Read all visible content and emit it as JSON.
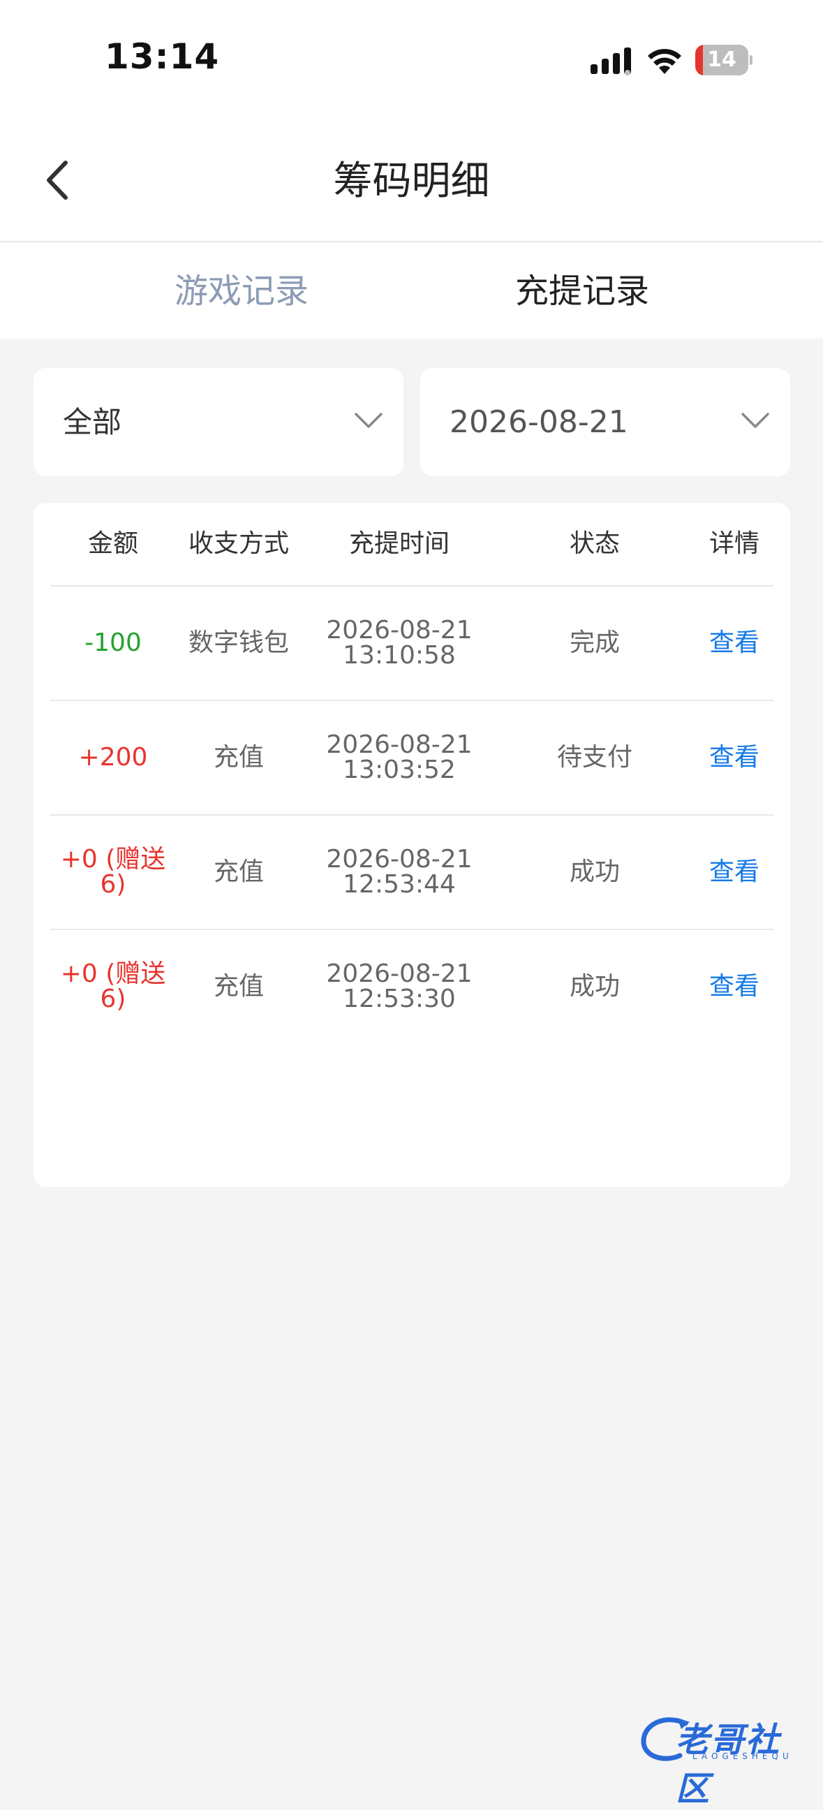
{
  "status_bar": {
    "time": "13:14",
    "battery_level": "14",
    "battery_percent": 14
  },
  "nav": {
    "title": "筹码明细"
  },
  "tabs": [
    {
      "label": "游戏记录",
      "active": false
    },
    {
      "label": "充提记录",
      "active": true
    }
  ],
  "filters": {
    "type": "全部",
    "date": "2026-08-21"
  },
  "table": {
    "headers": [
      "金额",
      "收支方式",
      "充提时间",
      "状态",
      "详情"
    ],
    "rows": [
      {
        "amount": "-100",
        "amount_line2": "",
        "method": "数字钱包",
        "date": "2026-08-21",
        "time": "13:10:58",
        "status": "完成",
        "detail": "查看"
      },
      {
        "amount": "+200",
        "amount_line2": "",
        "method": "充值",
        "date": "2026-08-21",
        "time": "13:03:52",
        "status": "待支付",
        "detail": "查看"
      },
      {
        "amount": "+0 (赠送",
        "amount_line2": "6)",
        "method": "充值",
        "date": "2026-08-21",
        "time": "12:53:44",
        "status": "成功",
        "detail": "查看"
      },
      {
        "amount": "+0 (赠送",
        "amount_line2": "6)",
        "method": "充值",
        "date": "2026-08-21",
        "time": "12:53:30",
        "status": "成功",
        "detail": "查看"
      }
    ]
  },
  "watermark": {
    "text": "老哥社区",
    "sub": "LAOGESHEQU"
  },
  "colors": {
    "accent_blue": "#1479e8",
    "negative_green": "#25a22f",
    "positive_red": "#e8342e",
    "inactive_tab": "#8c9cb5"
  }
}
